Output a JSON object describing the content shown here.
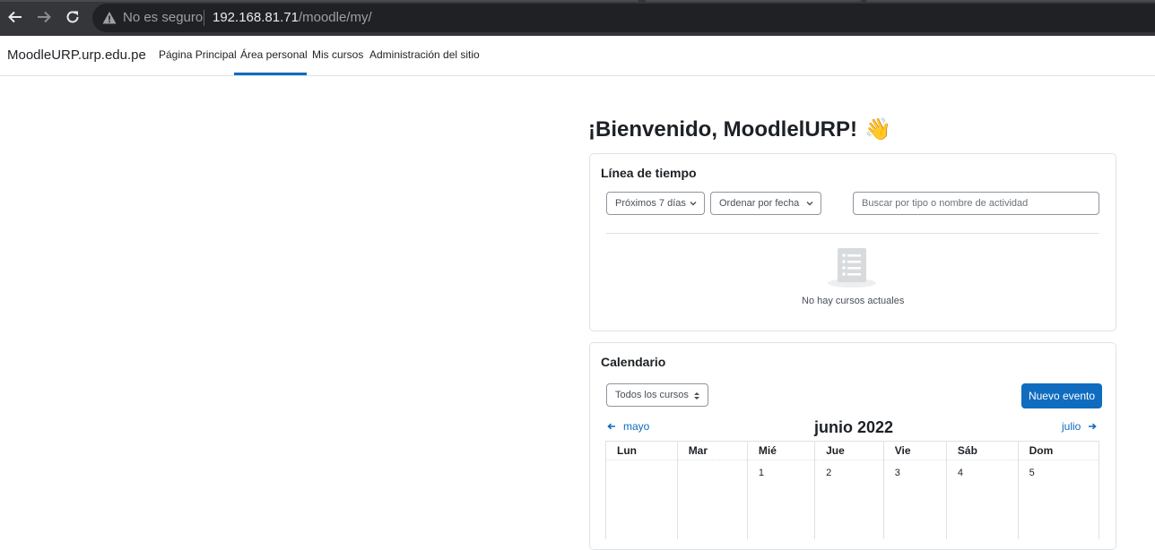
{
  "browser": {
    "security_label": "No es seguro",
    "url_host": "192.168.81.71",
    "url_path": "/moodle/my/"
  },
  "navbar": {
    "brand": "MoodleURP.urp.edu.pe",
    "links": [
      "Página Principal",
      "Área personal",
      "Mis cursos",
      "Administración del sitio"
    ],
    "active_index": 1
  },
  "welcome": {
    "text": "¡Bienvenido, MoodlelURP!",
    "emoji": "👋"
  },
  "timeline": {
    "title": "Línea de tiempo",
    "filter_value": "Próximos 7 días",
    "sort_value": "Ordenar por fecha",
    "search_placeholder": "Buscar por tipo o nombre de actividad",
    "empty_message": "No hay cursos actuales"
  },
  "calendar": {
    "title": "Calendario",
    "course_filter": "Todos los cursos",
    "new_event_label": "Nuevo evento",
    "prev_month": "mayo",
    "current_month": "junio 2022",
    "next_month": "julio",
    "weekdays": [
      "Lun",
      "Mar",
      "Mié",
      "Jue",
      "Vie",
      "Sáb",
      "Dom"
    ],
    "first_week": [
      "",
      "",
      "1",
      "2",
      "3",
      "4",
      "5"
    ]
  },
  "colors": {
    "accent": "#0f6cbf",
    "chrome_bg": "#35363a",
    "omnibox_bg": "#202124"
  }
}
